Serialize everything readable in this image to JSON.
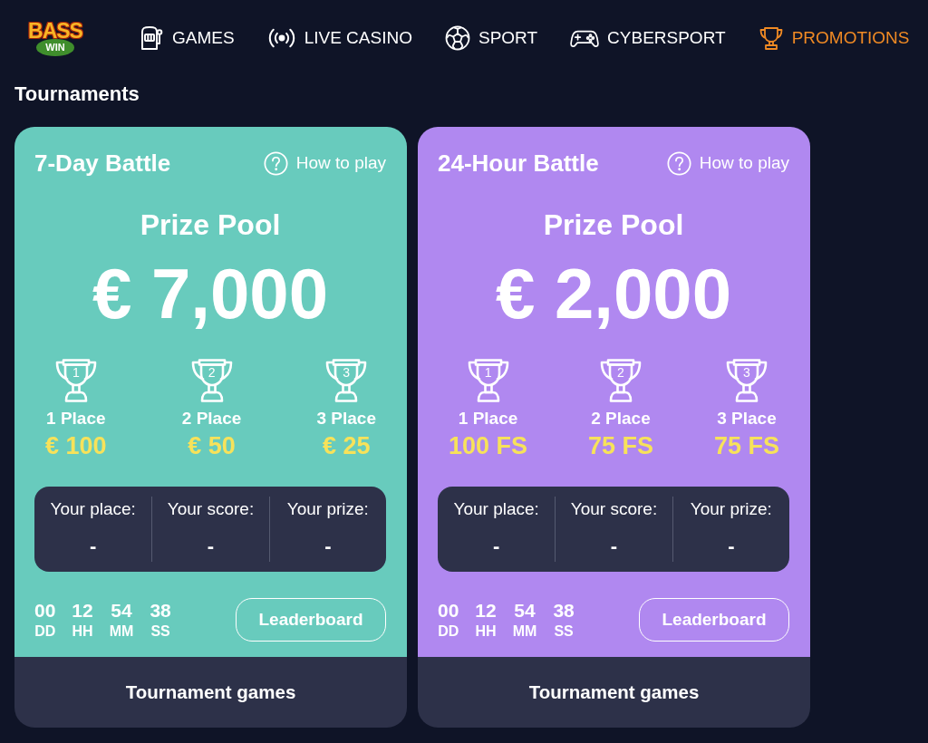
{
  "logo": {
    "wordmark": "BASS",
    "badge": "WIN"
  },
  "nav": [
    {
      "label": "GAMES",
      "kind": "slots",
      "selected": false
    },
    {
      "label": "LIVE CASINO",
      "kind": "live",
      "selected": false
    },
    {
      "label": "SPORT",
      "kind": "ball",
      "selected": false
    },
    {
      "label": "CYBERSPORT",
      "kind": "gamepad",
      "selected": false
    },
    {
      "label": "PROMOTIONS",
      "kind": "trophy",
      "selected": true
    }
  ],
  "heading": "Tournaments",
  "tournaments": [
    {
      "title": "7-Day Battle",
      "color": "#68cbbd",
      "help_link": "How to play",
      "prize_pool_label": "Prize Pool",
      "prize_pool": "€ 7,000",
      "places": [
        {
          "rank": "1",
          "label": "1 Place",
          "prize": "€ 100"
        },
        {
          "rank": "2",
          "label": "2 Place",
          "prize": "€ 50"
        },
        {
          "rank": "3",
          "label": "3 Place",
          "prize": "€ 25"
        }
      ],
      "stats": [
        {
          "label": "Your place:",
          "value": "-"
        },
        {
          "label": "Your score:",
          "value": "-"
        },
        {
          "label": "Your prize:",
          "value": "-"
        }
      ],
      "countdown": [
        {
          "value": "00",
          "unit": "DD"
        },
        {
          "value": "12",
          "unit": "HH"
        },
        {
          "value": "54",
          "unit": "MM"
        },
        {
          "value": "38",
          "unit": "SS"
        }
      ],
      "leaderboard_button": "Leaderboard",
      "games_button": "Tournament games"
    },
    {
      "title": "24-Hour Battle",
      "color": "#b088f0",
      "help_link": "How to play",
      "prize_pool_label": "Prize Pool",
      "prize_pool": "€ 2,000",
      "places": [
        {
          "rank": "1",
          "label": "1 Place",
          "prize": "100 FS"
        },
        {
          "rank": "2",
          "label": "2 Place",
          "prize": "75 FS"
        },
        {
          "rank": "3",
          "label": "3 Place",
          "prize": "75 FS"
        }
      ],
      "stats": [
        {
          "label": "Your place:",
          "value": "-"
        },
        {
          "label": "Your score:",
          "value": "-"
        },
        {
          "label": "Your prize:",
          "value": "-"
        }
      ],
      "countdown": [
        {
          "value": "00",
          "unit": "DD"
        },
        {
          "value": "12",
          "unit": "HH"
        },
        {
          "value": "54",
          "unit": "MM"
        },
        {
          "value": "38",
          "unit": "SS"
        }
      ],
      "leaderboard_button": "Leaderboard",
      "games_button": "Tournament games"
    }
  ]
}
